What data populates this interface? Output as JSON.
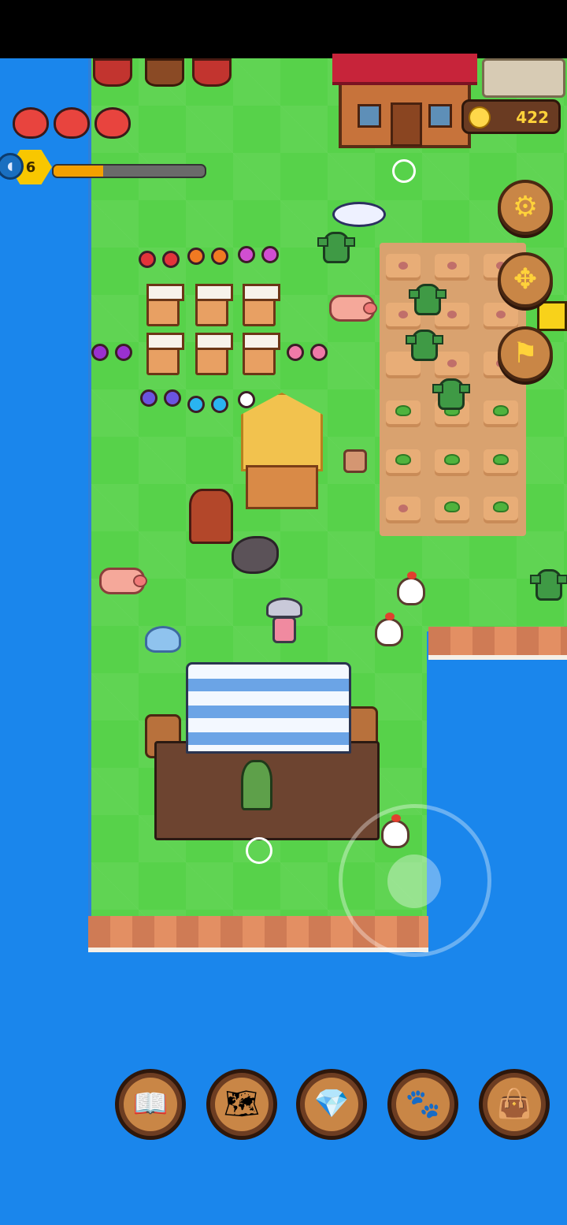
{
  "hud": {
    "hearts": 3,
    "level": "6",
    "xp_progress": 0.33,
    "coins": "422"
  },
  "side_buttons": [
    {
      "name": "settings",
      "icon": "gear-icon",
      "glyph": "⚙"
    },
    {
      "name": "move",
      "icon": "move-arrows-icon",
      "glyph": "✥"
    },
    {
      "name": "flag",
      "icon": "flag-icon",
      "glyph": "⚑"
    }
  ],
  "toolbar": [
    {
      "name": "journal",
      "icon": "book-icon",
      "glyph": "📖"
    },
    {
      "name": "map",
      "icon": "treasure-map-icon",
      "glyph": "🗺"
    },
    {
      "name": "shop",
      "icon": "gem-coin-icon",
      "glyph": "💎"
    },
    {
      "name": "pets",
      "icon": "paw-icon",
      "glyph": "🐾"
    },
    {
      "name": "inventory",
      "icon": "leather-bag-icon",
      "glyph": "👜"
    }
  ],
  "colors": {
    "water": "#1a86ec",
    "grass": "#57d24a",
    "accent_gold": "#ffd23a",
    "button_wood": "#c98646"
  }
}
